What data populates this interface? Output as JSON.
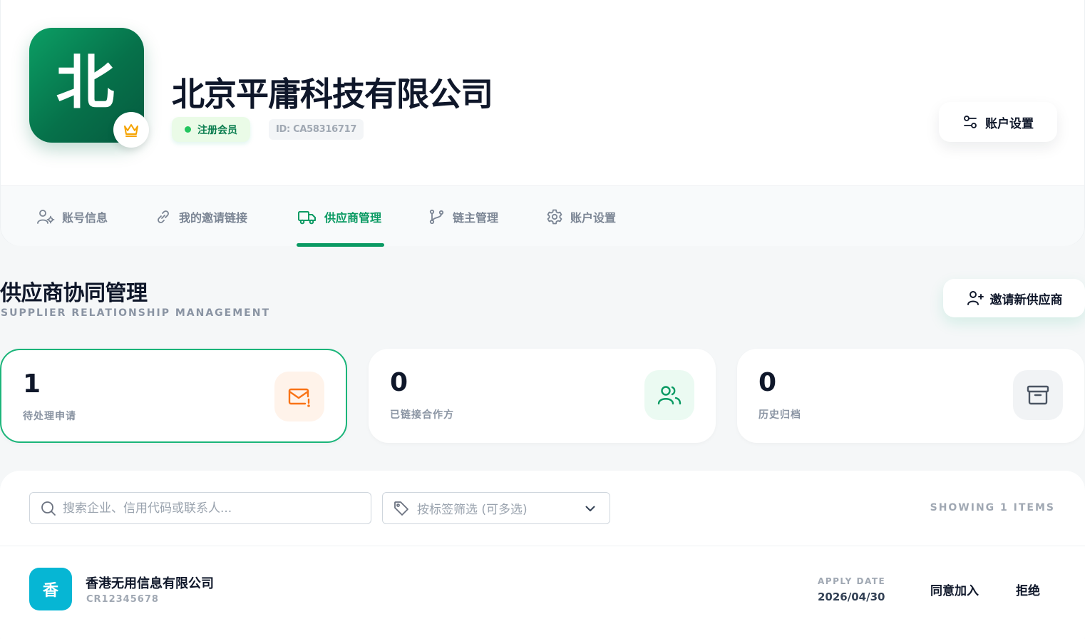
{
  "profile": {
    "logo_char": "北",
    "company_name": "北京平庸科技有限公司",
    "member_badge": "注册会员",
    "id_text": "ID: CA58316717",
    "account_settings_button": "账户设置"
  },
  "tabs": [
    {
      "label": "账号信息",
      "icon": "user-gear-icon"
    },
    {
      "label": "我的邀请链接",
      "icon": "link-icon"
    },
    {
      "label": "供应商管理",
      "icon": "truck-icon",
      "active": true
    },
    {
      "label": "链主管理",
      "icon": "git-branch-icon"
    },
    {
      "label": "账户设置",
      "icon": "gear-icon"
    }
  ],
  "section": {
    "title": "供应商协同管理",
    "subtitle": "SUPPLIER RELATIONSHIP MANAGEMENT",
    "invite_button": "邀请新供应商"
  },
  "stats": [
    {
      "value": "1",
      "label": "待处理申请",
      "icon": "mail-alert-icon"
    },
    {
      "value": "0",
      "label": "已链接合作方",
      "icon": "users-icon"
    },
    {
      "value": "0",
      "label": "历史归档",
      "icon": "archive-icon"
    }
  ],
  "filters": {
    "search_placeholder": "搜索企业、信用代码或联系人...",
    "tag_placeholder": "按标签筛选 (可多选)",
    "showing": "SHOWING 1 ITEMS"
  },
  "rows": [
    {
      "avatar_char": "香",
      "name": "香港无用信息有限公司",
      "code": "CR12345678",
      "date_label": "APPLY DATE",
      "date": "2026/04/30",
      "accept": "同意加入",
      "reject": "拒绝"
    }
  ],
  "colors": {
    "brand": "#0a9a63",
    "avatar_cyan": "#06b6d4",
    "pending_orange": "#f97316",
    "crown_gold": "#f5a300"
  }
}
